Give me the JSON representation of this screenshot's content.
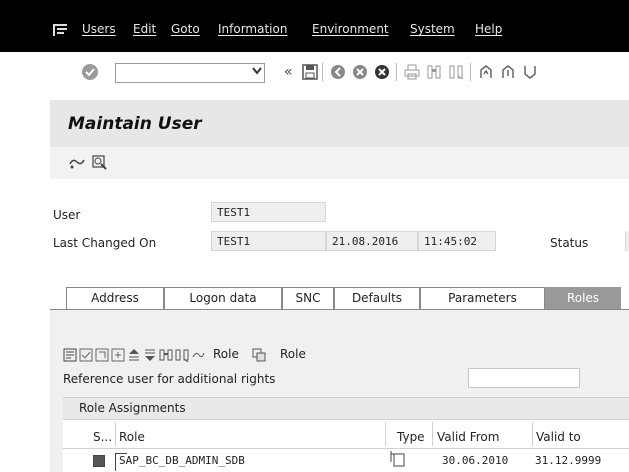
{
  "menubar": {
    "items": [
      {
        "id": "users",
        "label": "Users"
      },
      {
        "id": "edit",
        "label": "Edit"
      },
      {
        "id": "goto",
        "label": "Goto"
      },
      {
        "id": "information",
        "label": "Information"
      },
      {
        "id": "environment",
        "label": "Environment"
      },
      {
        "id": "system",
        "label": "System"
      },
      {
        "id": "help",
        "label": "Help"
      }
    ]
  },
  "toolbar": {
    "command_field_value": "",
    "back_arrows": "«"
  },
  "page": {
    "title": "Maintain User"
  },
  "header_fields": {
    "user_label": "User",
    "user_value": "TEST1",
    "last_changed_label": "Last Changed On",
    "last_changed_by": "TEST1",
    "last_changed_date": "21.08.2016",
    "last_changed_time": "11:45:02",
    "status_label": "Status"
  },
  "tabs": [
    {
      "label": "Address",
      "active": false
    },
    {
      "label": "Logon data",
      "active": false
    },
    {
      "label": "SNC",
      "active": false
    },
    {
      "label": "Defaults",
      "active": false
    },
    {
      "label": "Parameters",
      "active": false
    },
    {
      "label": "Roles",
      "active": true
    }
  ],
  "roles_tab": {
    "role_button_1_label": "Role",
    "role_button_2_label": "Role",
    "reference_user_label": "Reference user for additional rights",
    "reference_user_value": "",
    "section_title": "Role Assignments",
    "columns": [
      "S...",
      "Role",
      "Type",
      "Valid From",
      "Valid to"
    ],
    "rows": [
      {
        "status": "",
        "role": "SAP_BC_DB_ADMIN_SDB",
        "type": "",
        "valid_from": "30.06.2010",
        "valid_to": "31.12.9999"
      }
    ]
  },
  "colors": {
    "menubar_bg": "#000000",
    "title_bg": "#e7e7e7",
    "active_tab_bg": "#999999",
    "tab_area_bg": "#f0f0f0"
  }
}
